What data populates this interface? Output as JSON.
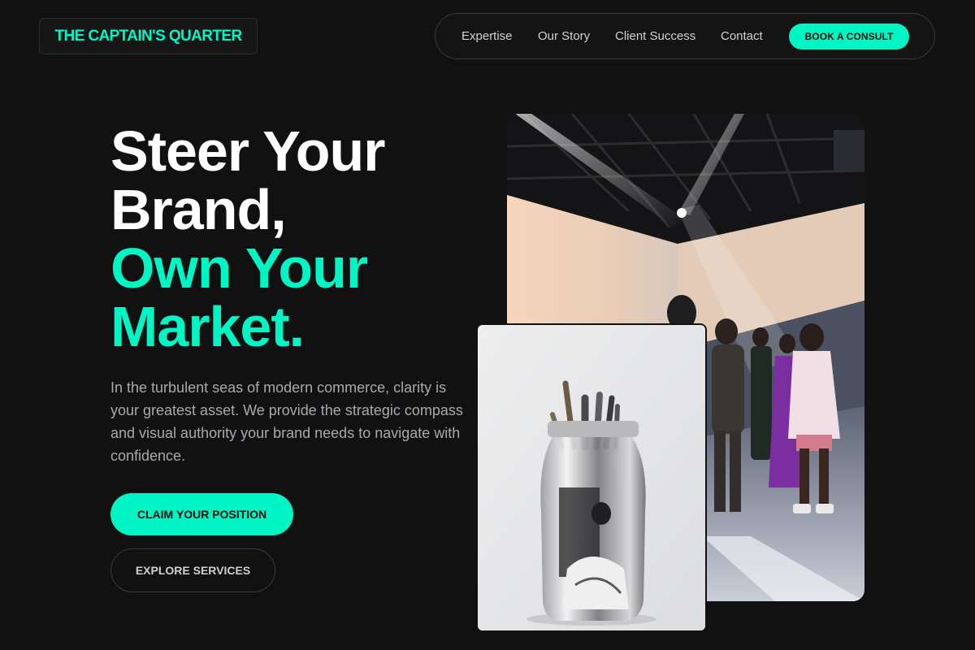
{
  "brand": {
    "name": "THE CAPTAIN'S QUARTER"
  },
  "nav": {
    "links": [
      "Expertise",
      "Our Story",
      "Client Success",
      "Contact"
    ],
    "cta": "BOOK A CONSULT"
  },
  "hero": {
    "headline": {
      "line1": "Steer Your",
      "line2": "Brand,",
      "line3": "Own Your",
      "line4": "Market."
    },
    "description": "In the turbulent seas of modern commerce, clarity is your greatest asset. We provide the strategic compass and visual authority your brand needs to navigate with confidence.",
    "primary_button": "CLAIM YOUR POSITION",
    "secondary_button": "EXPLORE SERVICES"
  },
  "colors": {
    "accent": "#00f5c4",
    "background": "#111112"
  },
  "images": {
    "main": "fashion-show-stage-photo",
    "secondary": "paintbrush-jar-photo"
  }
}
